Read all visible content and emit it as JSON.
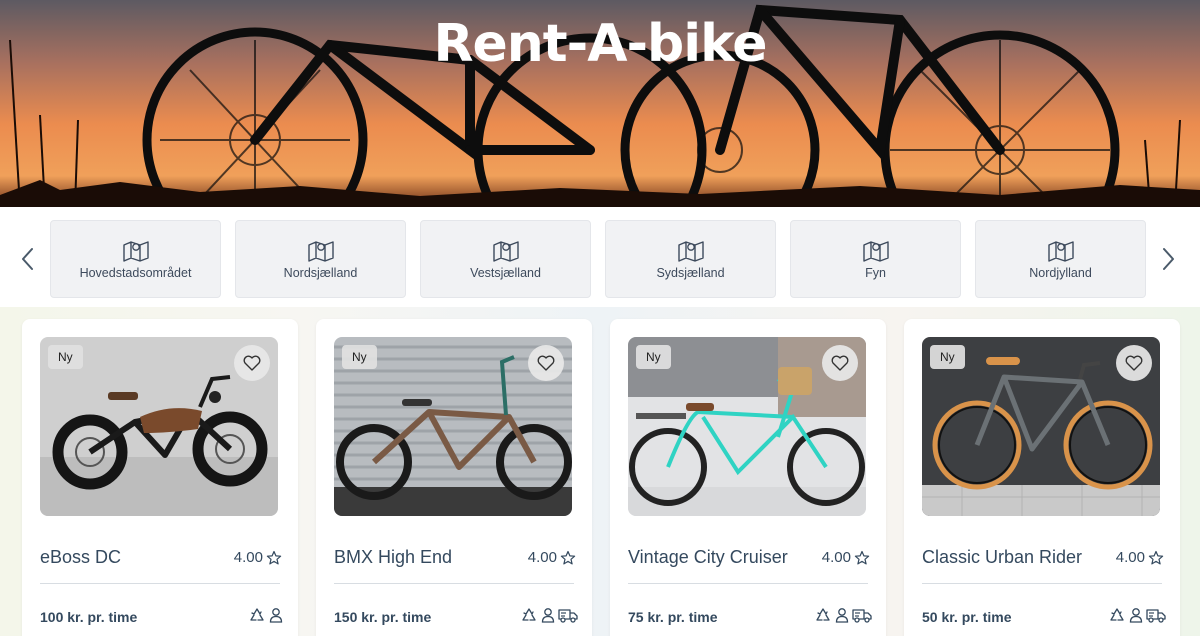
{
  "hero": {
    "title": "Rent-A-bike"
  },
  "regions": {
    "prev_icon": "chevron-left-icon",
    "next_icon": "chevron-right-icon",
    "items": [
      {
        "label": "Hovedstadsområdet",
        "icon": "map-icon"
      },
      {
        "label": "Nordsjælland",
        "icon": "map-icon"
      },
      {
        "label": "Vestsjælland",
        "icon": "map-icon"
      },
      {
        "label": "Sydsjælland",
        "icon": "map-icon"
      },
      {
        "label": "Fyn",
        "icon": "map-icon"
      },
      {
        "label": "Nordjylland",
        "icon": "map-icon"
      }
    ]
  },
  "products": [
    {
      "badge": "Ny",
      "name": "eBoss DC",
      "rating": "4.00",
      "price": "100 kr. pr. time",
      "features": [
        "recycle-icon",
        "person-icon"
      ],
      "frame_color": "#1a1a1a"
    },
    {
      "badge": "Ny",
      "name": "BMX High End",
      "rating": "4.00",
      "price": "150 kr. pr. time",
      "features": [
        "recycle-icon",
        "person-icon",
        "delivery-truck-icon"
      ],
      "frame_color": "#7a5a45"
    },
    {
      "badge": "Ny",
      "name": "Vintage City Cruiser",
      "rating": "4.00",
      "price": "75 kr. pr. time",
      "features": [
        "recycle-icon",
        "person-icon",
        "delivery-truck-icon"
      ],
      "frame_color": "#2fd3c3"
    },
    {
      "badge": "Ny",
      "name": "Classic Urban Rider",
      "rating": "4.00",
      "price": "50 kr. pr. time",
      "features": [
        "recycle-icon",
        "person-icon",
        "delivery-truck-icon"
      ],
      "frame_color": "#6b7175"
    }
  ],
  "colors": {
    "text": "#34495e",
    "star_outline": "#34495e",
    "region_bg": "#f1f2f4"
  }
}
